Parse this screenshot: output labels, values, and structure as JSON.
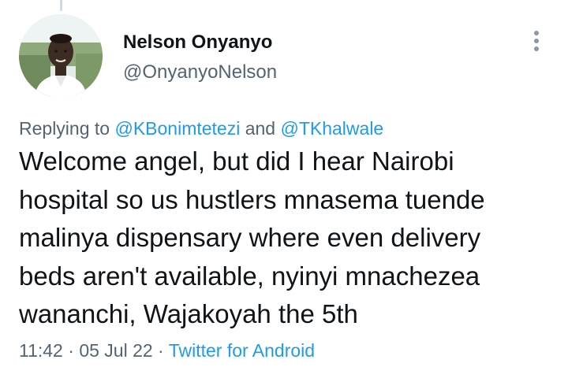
{
  "author": {
    "display_name": "Nelson Onyanyo",
    "handle": "@OnyanyoNelson"
  },
  "reply_context": {
    "prefix": "Replying to ",
    "mentions": [
      "@KBonimtetezi",
      "@TKhalwale"
    ],
    "conjunction": " and "
  },
  "tweet": {
    "lines": [
      "Welcome angel, but did I hear Nairobi",
      "hospital so us hustlers mnasema tuende",
      "malinya dispensary where even delivery",
      "beds aren't available, nyinyi mnachezea",
      "wananchi, Wajakoyah the 5th"
    ]
  },
  "meta": {
    "time": "11:42",
    "separator": " · ",
    "date": "05 Jul 22",
    "source": "Twitter for Android"
  },
  "icons": {
    "more": "more-vertical-icon"
  },
  "colors": {
    "link": "#1d9bf0",
    "secondary_text": "#536471",
    "primary_text": "#0f1419"
  }
}
